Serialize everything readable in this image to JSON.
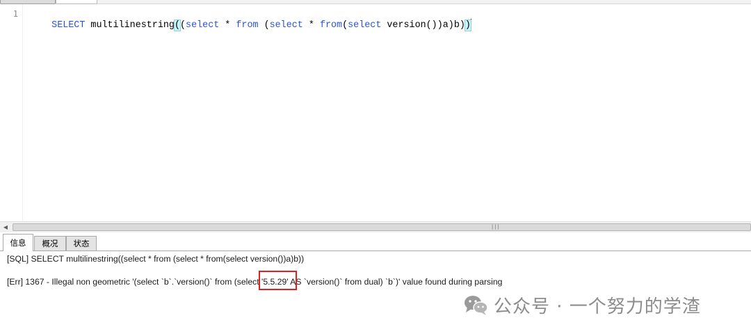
{
  "editor": {
    "line_number": "1",
    "tokens": [
      {
        "text": "SELECT",
        "style": "kw"
      },
      {
        "text": " multilinestring",
        "style": "id"
      },
      {
        "text": "(",
        "style": "hl"
      },
      {
        "text": "(",
        "style": "id"
      },
      {
        "text": "select",
        "style": "kw"
      },
      {
        "text": " * ",
        "style": "id"
      },
      {
        "text": "from",
        "style": "kw"
      },
      {
        "text": " (",
        "style": "id"
      },
      {
        "text": "select",
        "style": "kw"
      },
      {
        "text": " * ",
        "style": "id"
      },
      {
        "text": "from",
        "style": "kw"
      },
      {
        "text": "(",
        "style": "id"
      },
      {
        "text": "select",
        "style": "kw"
      },
      {
        "text": " version())a)b)",
        "style": "id"
      },
      {
        "text": ")",
        "style": "hl"
      }
    ]
  },
  "result_tabs": [
    {
      "label": "信息",
      "active": true
    },
    {
      "label": "概况",
      "active": false
    },
    {
      "label": "状态",
      "active": false
    }
  ],
  "output": {
    "sql_line": "[SQL] SELECT multilinestring((select * from (select * from(select version())a)b))",
    "err_line": "[Err] 1367 - Illegal non geometric '(select `b`.`version()` from (select '5.5.29' AS `version()` from dual) `b`)' value found during parsing"
  },
  "watermark": {
    "text": "公众号 · 一个努力的学渣",
    "icon": "wechat-logo-icon"
  },
  "colors": {
    "keyword": "#2a54d6",
    "highlight": "#c8f5f9",
    "annotation_red": "#e02020",
    "watermark": "#8c8c8c"
  }
}
